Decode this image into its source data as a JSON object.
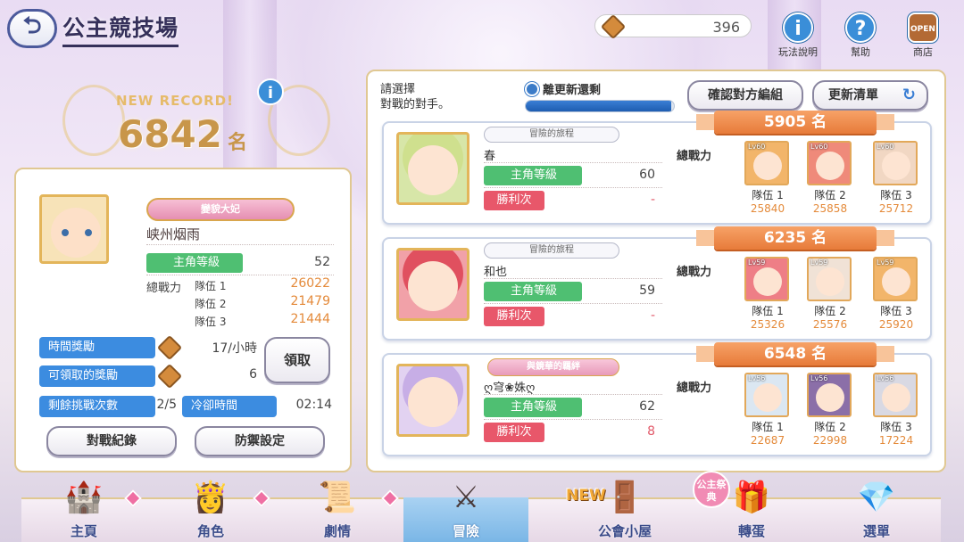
{
  "header": {
    "title": "公主競技場",
    "currency": "396",
    "buttons": [
      {
        "label": "玩法說明",
        "icon": "info-icon",
        "glyph": "i"
      },
      {
        "label": "幫助",
        "icon": "help-icon",
        "glyph": "?"
      },
      {
        "label": "商店",
        "icon": "shop-icon",
        "glyph": "OPEN"
      }
    ]
  },
  "record": {
    "label": "NEW RECORD!",
    "rank": "6842",
    "unit": "名"
  },
  "player": {
    "title_badge": "變貌大妃",
    "name": "峡州烟雨",
    "level_label": "主角等級",
    "level": "52",
    "power_label": "總戰力",
    "teams": [
      {
        "label": "隊伍 1",
        "power": "26022"
      },
      {
        "label": "隊伍 2",
        "power": "21479"
      },
      {
        "label": "隊伍 3",
        "power": "21444"
      }
    ]
  },
  "rewards": {
    "time_reward_label": "時間獎勵",
    "time_reward_value": "17/小時",
    "claimable_label": "可領取的獎勵",
    "claimable_value": "6",
    "claim_button": "領取",
    "remaining_label": "剩餘挑戰次數",
    "remaining_value": "2/5",
    "cooldown_label": "冷卻時間",
    "cooldown_value": "02:14"
  },
  "left_buttons": {
    "history": "對戰紀錄",
    "defense": "防禦設定"
  },
  "right": {
    "instruction_line1": "請選擇",
    "instruction_line2": "對戰的對手。",
    "timer_label": "離更新還剩",
    "timer_progress": 0.98,
    "confirm_button": "確認對方編組",
    "refresh_button": "更新清單"
  },
  "opponents": [
    {
      "route": "冒險的旅程",
      "route_style": "plain",
      "name": "春",
      "level_label": "主角等級",
      "level": "60",
      "wins_label": "勝利次",
      "wins": "-",
      "power_label": "總戰力",
      "rank": "5905 名",
      "teams": [
        {
          "lv": "Lv60",
          "label": "隊伍 1",
          "power": "25840",
          "color": "#f2b56a"
        },
        {
          "lv": "Lv60",
          "label": "隊伍 2",
          "power": "25858",
          "color": "#ef8a7a"
        },
        {
          "lv": "Lv60",
          "label": "隊伍 3",
          "power": "25712",
          "color": "#f1d7c3"
        }
      ],
      "portrait_color": "#d7e6a8",
      "hair_color": "#cfe08e"
    },
    {
      "route": "冒險的旅程",
      "route_style": "plain",
      "name": "和也",
      "level_label": "主角等級",
      "level": "59",
      "wins_label": "勝利次",
      "wins": "-",
      "power_label": "總戰力",
      "rank": "6235 名",
      "teams": [
        {
          "lv": "Lv59",
          "label": "隊伍 1",
          "power": "25326",
          "color": "#ee7e86"
        },
        {
          "lv": "Lv59",
          "label": "隊伍 2",
          "power": "25576",
          "color": "#f0e2d6"
        },
        {
          "lv": "Lv59",
          "label": "隊伍 3",
          "power": "25920",
          "color": "#f2b56a"
        }
      ],
      "portrait_color": "#f1a1a8",
      "hair_color": "#e0505f"
    },
    {
      "route": "與鏡華的羈絆",
      "route_style": "badge",
      "name": "ღ穹❀姝ღ",
      "level_label": "主角等級",
      "level": "62",
      "wins_label": "勝利次",
      "wins": "8",
      "power_label": "總戰力",
      "rank": "6548 名",
      "teams": [
        {
          "lv": "Lv56",
          "label": "隊伍 1",
          "power": "22687",
          "color": "#dbe7f2"
        },
        {
          "lv": "Lv56",
          "label": "隊伍 2",
          "power": "22998",
          "color": "#8b6fa8"
        },
        {
          "lv": "Lv56",
          "label": "隊伍 3",
          "power": "17224",
          "color": "#d9d9e3"
        }
      ],
      "portrait_color": "#e2d2f1",
      "hair_color": "#c7aee6"
    }
  ],
  "nav": [
    {
      "label": "主頁",
      "icon": "castle-icon",
      "glyph": "🏰"
    },
    {
      "label": "角色",
      "icon": "character-icon",
      "glyph": "👸"
    },
    {
      "label": "劇情",
      "icon": "scroll-icon",
      "glyph": "📜"
    },
    {
      "label": "冒險",
      "icon": "swords-icon",
      "glyph": "⚔"
    },
    {
      "label": "公會小屋",
      "icon": "guild-door-icon",
      "glyph": "🚪"
    },
    {
      "label": "轉蛋",
      "icon": "gacha-icon",
      "glyph": "🎁"
    },
    {
      "label": "選單",
      "icon": "menu-crystal-icon",
      "glyph": "💎"
    }
  ],
  "nav_tags": {
    "new": "NEW",
    "event": "公主祭典"
  }
}
